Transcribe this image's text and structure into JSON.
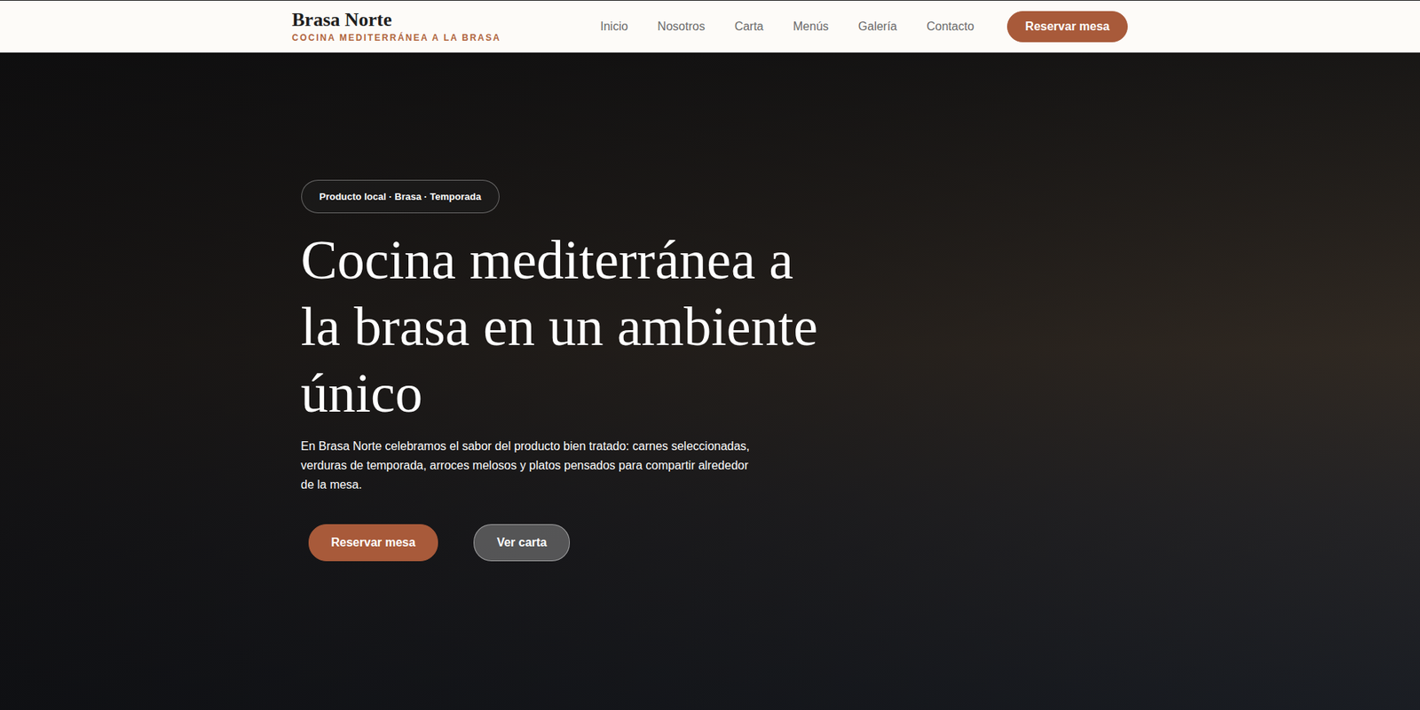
{
  "header": {
    "brand": {
      "name": "Brasa Norte",
      "tagline": "COCINA MEDITERRÁNEA A LA BRASA"
    },
    "nav": [
      {
        "label": "Inicio",
        "selected": false
      },
      {
        "label": "Nosotros",
        "selected": false
      },
      {
        "label": "Carta",
        "selected": false
      },
      {
        "label": "Menús",
        "selected": false
      },
      {
        "label": "Galería",
        "selected": false
      },
      {
        "label": "Contacto",
        "selected": false
      }
    ],
    "cta": "Reservar mesa"
  },
  "hero": {
    "badge": "Producto local · Brasa · Temporada",
    "title": "Cocina mediterránea a la brasa en un ambiente único",
    "description": "En Brasa Norte celebramos el sabor del producto bien tratado: carnes seleccionadas, verduras de temporada, arroces melosos y platos pensados para compartir alrededor de la mesa.",
    "buttons": [
      {
        "label": "Reservar mesa",
        "kind": "primary"
      },
      {
        "label": "Ver carta",
        "kind": "secondary"
      }
    ]
  }
}
